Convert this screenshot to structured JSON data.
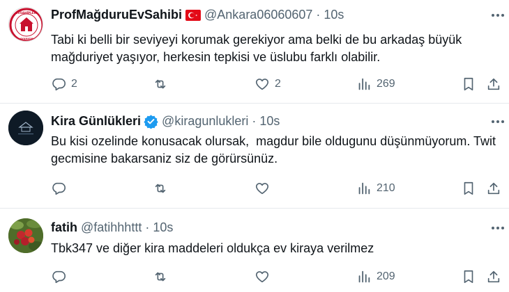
{
  "tweets": [
    {
      "name": "ProfMağduruEvSahibi",
      "handle": "@Ankara06060607",
      "dot": "·",
      "time": "10s",
      "text": "Tabi ki belli bir seviyeyi korumak gerekiyor ama belki de bu arkadaş büyük mağduriyet yaşıyor, herkesin tepkisi ve üslubu farklı olabilir.",
      "replies": "2",
      "retweets": "",
      "likes": "2",
      "views": "269",
      "badge": "turkey-flag",
      "avatar_text": "EVSAHİPLERİ DAYANIŞMA"
    },
    {
      "name": "Kira Günlükleri",
      "handle": "@kiragunlukleri",
      "dot": "·",
      "time": "10s",
      "text": "Bu kisi ozelinde konusacak olursak,  magdur bile oldugunu düşünmüyorum. Twit gecmisine bakarsaniz siz de görürsünüz.",
      "replies": "",
      "retweets": "",
      "likes": "",
      "views": "210",
      "badge": "verified-check"
    },
    {
      "name": "fatih",
      "handle": "@fatihhhttt",
      "dot": "·",
      "time": "10s",
      "text": "Tbk347 ve diğer kira maddeleri oldukça ev kiraya verilmez",
      "replies": "",
      "retweets": "",
      "likes": "",
      "views": "209",
      "badge": ""
    }
  ],
  "colors": {
    "text": "#0f1419",
    "muted": "#536471",
    "verified": "#1d9bf0",
    "divider": "#e6e9ec"
  }
}
